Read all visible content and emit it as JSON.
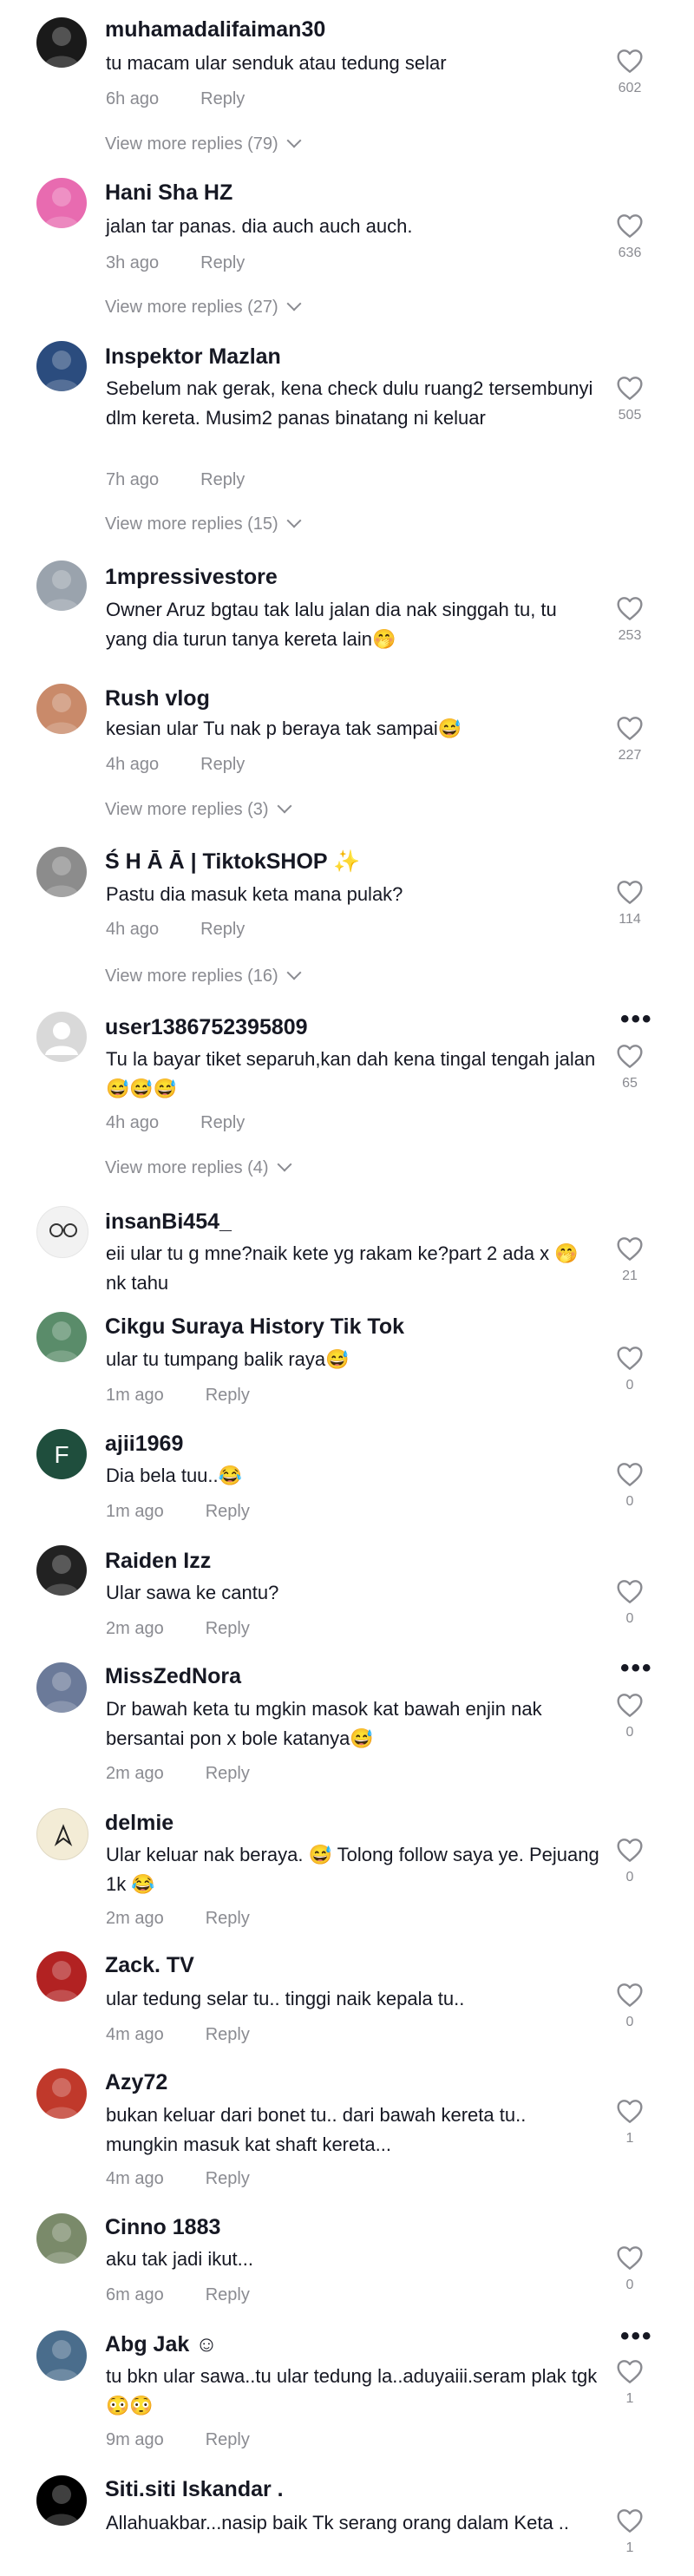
{
  "comments": [
    {
      "user": "muhamadalifaiman30",
      "text": "tu macam ular senduk atau tedung selar",
      "time": "6h ago",
      "reply": "Reply",
      "likes": "602",
      "more_replies": "View more replies (79)",
      "avatar_color": "#1a1a1a"
    },
    {
      "user": "Hani Sha HZ",
      "text": "jalan tar panas. dia auch auch auch.",
      "time": "3h ago",
      "reply": "Reply",
      "likes": "636",
      "more_replies": "View more replies (27)",
      "avatar_color": "#e86bb0"
    },
    {
      "user": "Inspektor Mazlan",
      "text": "Sebelum nak gerak, kena check dulu ruang2 tersembunyi dlm kereta. Musim2 panas binatang ni keluar",
      "time": "7h ago",
      "reply": "Reply",
      "likes": "505",
      "more_replies": "View more replies (15)",
      "avatar_color": "#2b4c7e"
    },
    {
      "user": "1mpressivestore",
      "text": "Owner Aruz bgtau tak lalu jalan dia nak singgah tu, tu yang dia turun tanya kereta lain🤭",
      "time": "",
      "reply": "",
      "likes": "253",
      "more_replies": "",
      "avatar_color": "#9aa3ad"
    },
    {
      "user": "Rush vlog",
      "text": "kesian ular Tu nak p beraya tak sampai😅",
      "time": "4h ago",
      "reply": "Reply",
      "likes": "227",
      "more_replies": "View more replies (3)",
      "avatar_color": "#c98a6a"
    },
    {
      "user": "Ś H Ā Ā | TiktokSHOP ✨",
      "text": "Pastu dia masuk keta mana pulak?",
      "time": "4h ago",
      "reply": "Reply",
      "likes": "114",
      "more_replies": "View more replies (16)",
      "avatar_color": "#8c8c8c"
    },
    {
      "user": "user1386752395809",
      "text": "Tu la bayar tiket separuh,kan dah kena tingal tengah jalan😅😅😅",
      "time": "4h ago",
      "reply": "Reply",
      "likes": "65",
      "more_replies": "View more replies (4)",
      "avatar_color": "#d9d9d9",
      "dots": true
    },
    {
      "user": "insanBi454_",
      "text": "eii ular tu g mne?naik kete yg rakam ke?part 2 ada x 🤭 nk tahu",
      "time": "",
      "reply": "",
      "likes": "21",
      "more_replies": "",
      "avatar_color": "#f2f2f2"
    },
    {
      "user": "Cikgu Suraya History Tik Tok",
      "text": "ular tu tumpang balik raya😅",
      "time": "1m ago",
      "reply": "Reply",
      "likes": "0",
      "more_replies": "",
      "avatar_color": "#5a8c6a"
    },
    {
      "user": "ajii1969",
      "text": "Dia bela tuu..😂",
      "time": "1m ago",
      "reply": "Reply",
      "likes": "0",
      "more_replies": "",
      "avatar_color": "#1f4e3d",
      "initial": "F"
    },
    {
      "user": "Raiden Izz",
      "text": "Ular sawa ke cantu?",
      "time": "2m ago",
      "reply": "Reply",
      "likes": "0",
      "more_replies": "",
      "avatar_color": "#222222"
    },
    {
      "user": "MissZedNora",
      "text": "Dr bawah keta tu mgkin masok kat bawah enjin nak bersantai pon x bole katanya😅",
      "time": "2m ago",
      "reply": "Reply",
      "likes": "0",
      "more_replies": "",
      "avatar_color": "#6b7a99",
      "dots": true
    },
    {
      "user": "delmie",
      "text": "Ular keluar nak beraya. 😅 Tolong follow saya ye. Pejuang 1k 😂",
      "time": "2m ago",
      "reply": "Reply",
      "likes": "0",
      "more_replies": "",
      "avatar_color": "#f3ecd6"
    },
    {
      "user": "Zack. TV",
      "text": "ular tedung selar tu.. tinggi naik kepala tu..",
      "time": "4m ago",
      "reply": "Reply",
      "likes": "0",
      "more_replies": "",
      "avatar_color": "#b22222"
    },
    {
      "user": "Azy72",
      "text": "bukan keluar dari bonet tu.. dari bawah kereta tu.. mungkin masuk kat shaft kereta...",
      "time": "4m ago",
      "reply": "Reply",
      "likes": "1",
      "more_replies": "",
      "avatar_color": "#c0392b"
    },
    {
      "user": "Cinno 1883",
      "text": "aku tak jadi ikut...",
      "time": "6m ago",
      "reply": "Reply",
      "likes": "0",
      "more_replies": "",
      "avatar_color": "#7a8a6a"
    },
    {
      "user": "Abg Jak ☺",
      "text": "tu bkn ular sawa..tu ular tedung la..aduyaiii.seram plak tgk😳😳",
      "time": "9m ago",
      "reply": "Reply",
      "likes": "1",
      "more_replies": "",
      "avatar_color": "#4a6d8c",
      "dots": true
    },
    {
      "user": "Siti.siti Iskandar .",
      "text": "Allahuakbar...nasip baik Tk serang orang dalam Keta ..",
      "time": "",
      "reply": "",
      "likes": "1",
      "more_replies": "",
      "avatar_color": "#000000"
    }
  ]
}
